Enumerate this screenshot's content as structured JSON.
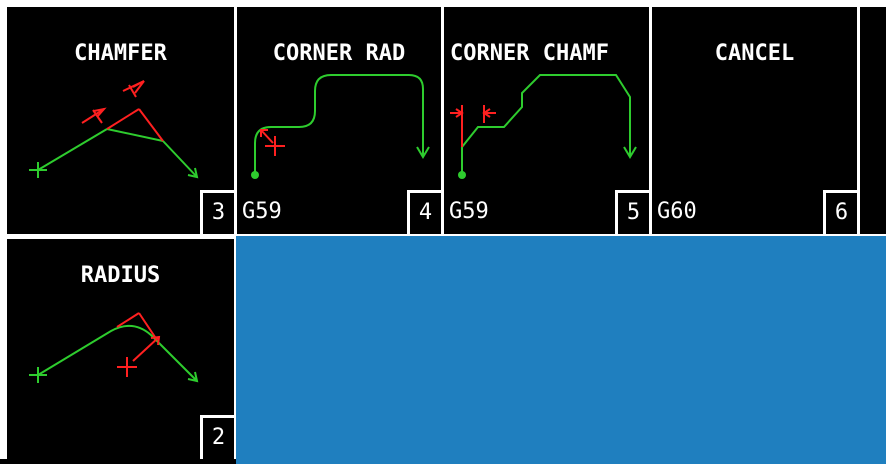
{
  "softkeys": {
    "chamfer": {
      "title": "CHAMFER",
      "number": "3",
      "icon": "chamfer-diagram-icon"
    },
    "corner_rad": {
      "title": "CORNER RAD",
      "code": "G59",
      "number": "4",
      "icon": "corner-radius-path-icon"
    },
    "corner_chamf": {
      "title": "CORNER CHAMF",
      "code": "G59",
      "number": "5",
      "icon": "corner-chamfer-path-icon"
    },
    "cancel": {
      "title": "CANCEL",
      "code": "G60",
      "number": "6"
    },
    "radius": {
      "title": "RADIUS",
      "number": "2",
      "icon": "radius-diagram-icon"
    }
  },
  "colors": {
    "tile_background": "#000000",
    "text": "#ffffff",
    "path_green": "#2ecc2e",
    "dimension_red": "#ff2020",
    "empty_area_blue": "#1f7fbf"
  }
}
